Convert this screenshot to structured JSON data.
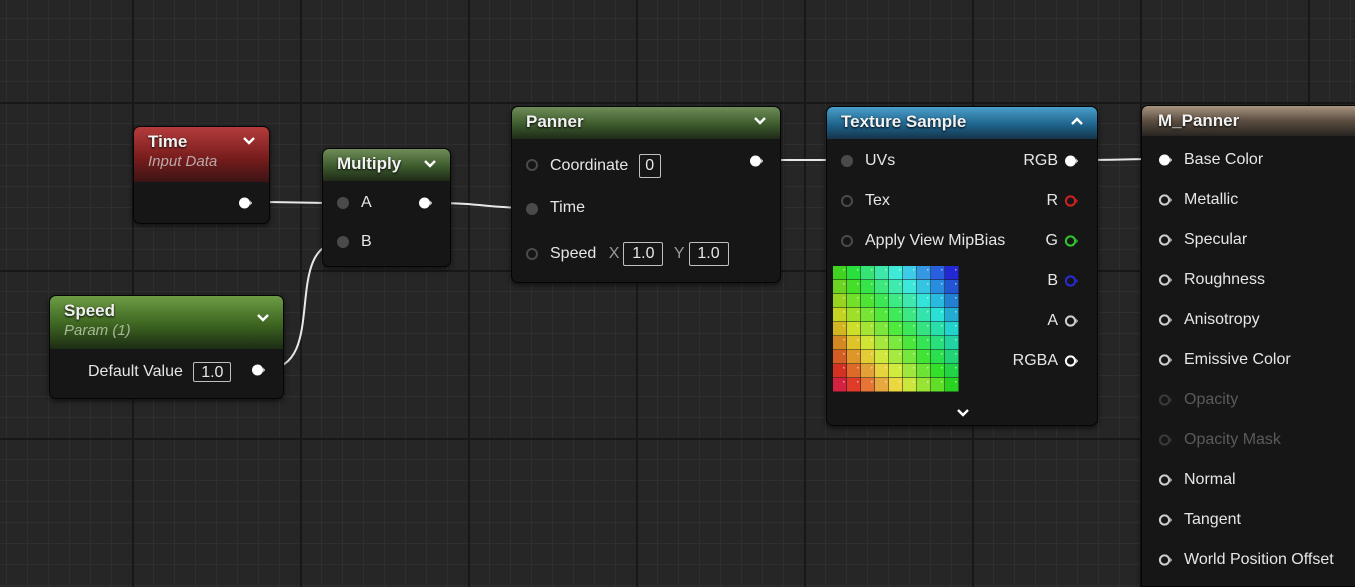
{
  "graph": {
    "nodes": {
      "time": {
        "title": "Time",
        "subtitle": "Input Data"
      },
      "speed": {
        "title": "Speed",
        "subtitle": "Param (1)",
        "default_label": "Default Value",
        "default_value": "1.0"
      },
      "multiply": {
        "title": "Multiply",
        "inputs": [
          "A",
          "B"
        ]
      },
      "panner": {
        "title": "Panner",
        "coordinate_label": "Coordinate",
        "coordinate_value": "0",
        "time_label": "Time",
        "speed_label": "Speed",
        "speed_x_label": "X",
        "speed_x": "1.0",
        "speed_y_label": "Y",
        "speed_y": "1.0"
      },
      "texture_sample": {
        "title": "Texture Sample",
        "inputs": [
          "UVs",
          "Tex",
          "Apply View MipBias"
        ],
        "outputs": [
          "RGB",
          "R",
          "G",
          "B",
          "A",
          "RGBA"
        ],
        "output_colors": {
          "RGB": "#ffffff",
          "R": "#d12020",
          "G": "#2fc82f",
          "B": "#2a2ad8",
          "A": "#cfcfcf",
          "RGBA": "#ffffff"
        }
      },
      "material": {
        "title": "M_Panner",
        "inputs": [
          {
            "label": "Base Color",
            "enabled": true,
            "connected": true
          },
          {
            "label": "Metallic",
            "enabled": true,
            "connected": false
          },
          {
            "label": "Specular",
            "enabled": true,
            "connected": false
          },
          {
            "label": "Roughness",
            "enabled": true,
            "connected": false
          },
          {
            "label": "Anisotropy",
            "enabled": true,
            "connected": false
          },
          {
            "label": "Emissive Color",
            "enabled": true,
            "connected": false
          },
          {
            "label": "Opacity",
            "enabled": false,
            "connected": false
          },
          {
            "label": "Opacity Mask",
            "enabled": false,
            "connected": false
          },
          {
            "label": "Normal",
            "enabled": true,
            "connected": false
          },
          {
            "label": "Tangent",
            "enabled": true,
            "connected": false
          },
          {
            "label": "World Position Offset",
            "enabled": true,
            "connected": false
          }
        ]
      }
    },
    "icons": {
      "collapse": "chevron-down-icon",
      "expand": "chevron-up-icon",
      "pin": "exec-pin-icon",
      "preview": "texture-preview"
    },
    "colors": {
      "wire": "#e8e8e8",
      "grid_major": "#181818",
      "grid_minor": "#2f2f2f",
      "background": "#262626",
      "time_header": "#8a2626",
      "speed_header": "#4a7a2a",
      "multiply_header": "#4c6b3c",
      "panner_header": "#4c6b3c",
      "texture_header": "#2a7aa6",
      "material_header": "#6e6052",
      "pin_unconnected": "#4a4a4a",
      "pin_disabled": "#3a3a3a"
    }
  }
}
